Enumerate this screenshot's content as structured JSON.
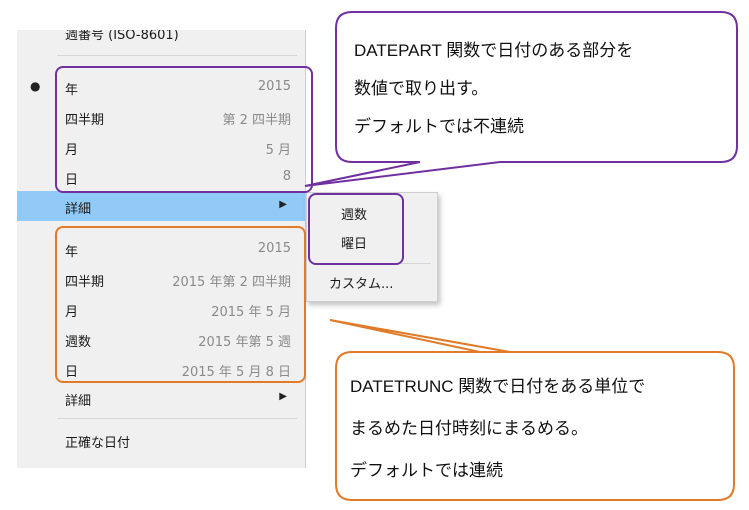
{
  "menu": {
    "top_partial": "週番号 (ISO-8601)",
    "datepart_items": [
      {
        "label": "年",
        "value": "2015",
        "selected": true
      },
      {
        "label": "四半期",
        "value": "第 2 四半期"
      },
      {
        "label": "月",
        "value": "5 月"
      },
      {
        "label": "日",
        "value": "8"
      }
    ],
    "detail1_label": "詳細",
    "detail1_arrow": "▶",
    "datetrunc_items": [
      {
        "label": "年",
        "value": "2015"
      },
      {
        "label": "四半期",
        "value": "2015 年第 2 四半期"
      },
      {
        "label": "月",
        "value": "2015 年 5 月"
      },
      {
        "label": "週数",
        "value": "2015 年第 5 週"
      },
      {
        "label": "日",
        "value": "2015 年 5 月 8 日"
      }
    ],
    "detail2_label": "詳細",
    "detail2_arrow": "▶",
    "exact_date_label": "正確な日付"
  },
  "submenu": {
    "items": [
      "週数",
      "曜日"
    ],
    "custom_label": "カスタム..."
  },
  "callout_datepart": {
    "lines": [
      "DATEPART 関数で日付のある部分を",
      "数値で取り出す。",
      "デフォルトでは不連続"
    ]
  },
  "callout_datetrunc": {
    "lines": [
      "DATETRUNC 関数で日付をある単位で",
      "まるめた日付時刻にまるめる。",
      "デフォルトでは連続"
    ]
  },
  "colors": {
    "purple": "#7030a0",
    "orange": "#e07b2a",
    "highlight": "#91c9f7"
  }
}
